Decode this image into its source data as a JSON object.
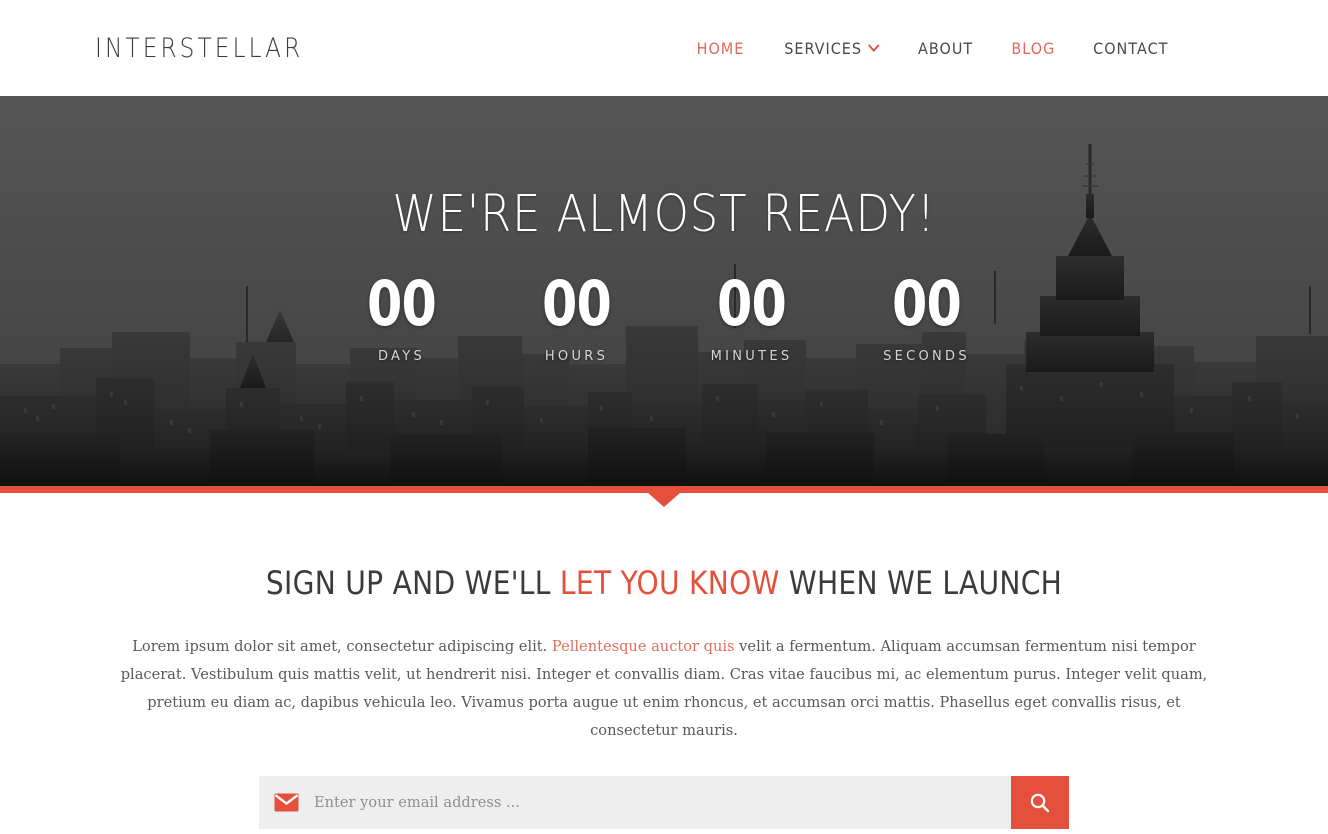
{
  "header": {
    "brand": "INTERSTELLAR",
    "nav": [
      {
        "label": "HOME",
        "accent": true,
        "icon": null
      },
      {
        "label": "SERVICES",
        "accent": false,
        "icon": "chevron-down-icon"
      },
      {
        "label": "ABOUT",
        "accent": false,
        "icon": null
      },
      {
        "label": "BLOG",
        "accent": true,
        "icon": null
      },
      {
        "label": "CONTACT",
        "accent": false,
        "icon": null
      }
    ]
  },
  "hero": {
    "title": "WE'RE ALMOST READY!",
    "countdown": [
      {
        "value": "00",
        "label": "DAYS"
      },
      {
        "value": "00",
        "label": "HOURS"
      },
      {
        "value": "00",
        "label": "MINUTES"
      },
      {
        "value": "00",
        "label": "SECONDS"
      }
    ]
  },
  "signup": {
    "title_part1": "SIGN UP AND WE'LL ",
    "title_accent": "LET YOU KNOW",
    "title_part2": " WHEN WE LAUNCH",
    "paragraph_part1": "Lorem ipsum dolor sit amet, consectetur adipiscing elit. ",
    "paragraph_link": "Pellentesque auctor quis",
    "paragraph_part2": " velit a fermentum. Aliquam accumsan fermentum nisi tempor placerat. Vestibulum quis mattis velit, ut hendrerit nisi. Integer et convallis diam. Cras vitae faucibus mi, ac elementum purus. Integer velit quam, pretium eu diam ac, dapibus vehicula leo. Vivamus porta augue ut enim rhoncus, et accumsan orci mattis. Phasellus eget convallis risus, et consectetur mauris.",
    "email_placeholder": "Enter your email address ...",
    "email_value": "",
    "envelope_icon": "envelope-icon",
    "submit_icon": "search-icon"
  },
  "colors": {
    "accent": "#e4503c",
    "accent_light": "#e06a5a",
    "text_dark": "#3b3b3b",
    "hero_sky": "#4e4e4e",
    "field_bg": "#eeeeee"
  }
}
